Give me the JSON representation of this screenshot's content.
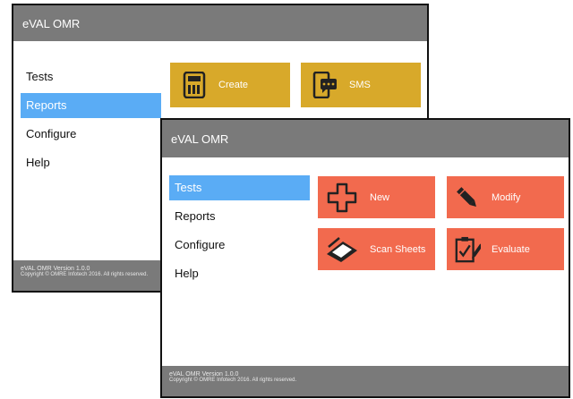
{
  "app": {
    "title": "eVAL OMR"
  },
  "back_window": {
    "nav": [
      {
        "label": "Tests"
      },
      {
        "label": "Reports"
      },
      {
        "label": "Configure"
      },
      {
        "label": "Help"
      }
    ],
    "active_nav": "Reports",
    "tiles": [
      {
        "label": "Create",
        "icon": "calculator-icon"
      },
      {
        "label": "SMS",
        "icon": "sms-phone-icon"
      }
    ],
    "footer": {
      "version": "eVAL OMR Version 1.0.0",
      "copyright": "Copyright © OMRE Infotech 2016. All rights reserved."
    }
  },
  "front_window": {
    "nav": [
      {
        "label": "Tests"
      },
      {
        "label": "Reports"
      },
      {
        "label": "Configure"
      },
      {
        "label": "Help"
      }
    ],
    "active_nav": "Tests",
    "tiles": [
      {
        "label": "New",
        "icon": "plus-icon"
      },
      {
        "label": "Modify",
        "icon": "pencil-icon"
      },
      {
        "label": "Scan Sheets",
        "icon": "scanner-icon"
      },
      {
        "label": "Evaluate",
        "icon": "checklist-icon"
      }
    ],
    "footer": {
      "version": "eVAL OMR Version 1.0.0",
      "copyright": "Copyright © OMRE Infotech 2016. All rights reserved."
    }
  },
  "colors": {
    "titlebar": "#7a7a7a",
    "active_nav": "#5aacf5",
    "tile_gold": "#d8a92a",
    "tile_red": "#f26a4e"
  }
}
